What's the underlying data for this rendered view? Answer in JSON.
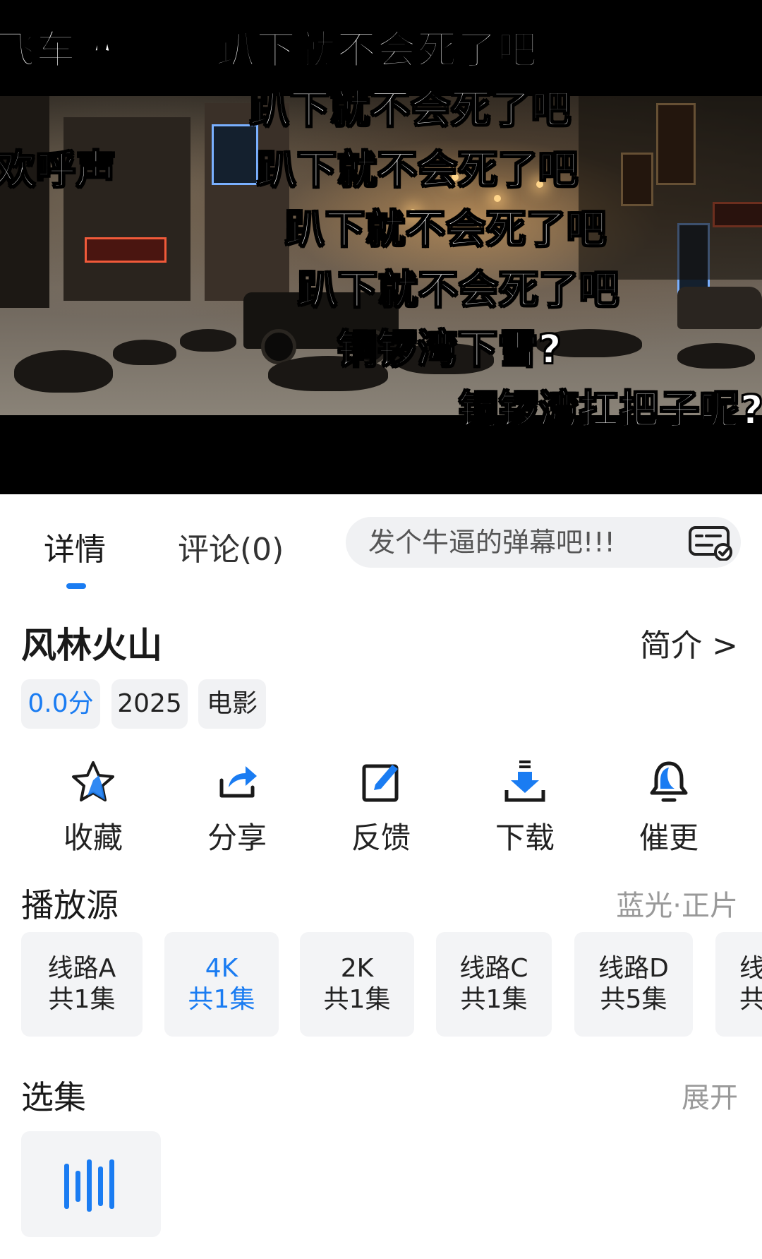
{
  "player": {
    "danmaku": [
      "飞车嘛",
      "趴下就不会死了吧",
      "趴下就不会死了吧",
      "欢呼声",
      "趴下就不会死了吧",
      "趴下就不会死了吧",
      "趴下就不会死了吧",
      "铜锣湾下雪?",
      "铜锣湾扛把子呢?"
    ]
  },
  "tabs": {
    "detail": "详情",
    "comments": "评论(0)"
  },
  "danmaku_input": {
    "placeholder": "发个牛逼的弹幕吧!!!"
  },
  "movie": {
    "title": "风林火山",
    "intro_link": "简介 >",
    "score": "0.0分",
    "year": "2025",
    "type": "电影"
  },
  "actions": [
    {
      "label": "收藏",
      "icon": "star-icon"
    },
    {
      "label": "分享",
      "icon": "share-icon"
    },
    {
      "label": "反馈",
      "icon": "edit-icon"
    },
    {
      "label": "下载",
      "icon": "download-icon"
    },
    {
      "label": "催更",
      "icon": "bell-icon"
    }
  ],
  "sources": {
    "heading": "播放源",
    "quality": "蓝光·正片",
    "items": [
      {
        "name": "线路A",
        "episodes": "共1集",
        "active": false
      },
      {
        "name": "4K",
        "episodes": "共1集",
        "active": true
      },
      {
        "name": "2K",
        "episodes": "共1集",
        "active": false
      },
      {
        "name": "线路C",
        "episodes": "共1集",
        "active": false
      },
      {
        "name": "线路D",
        "episodes": "共5集",
        "active": false
      },
      {
        "name": "线",
        "episodes": "共",
        "active": false
      }
    ]
  },
  "episodes": {
    "heading": "选集",
    "expand": "展开",
    "playing_icon": "playing-bars-icon"
  },
  "colors": {
    "accent": "#1a7cf2",
    "muted": "#999999",
    "card_bg": "#f3f4f6"
  }
}
